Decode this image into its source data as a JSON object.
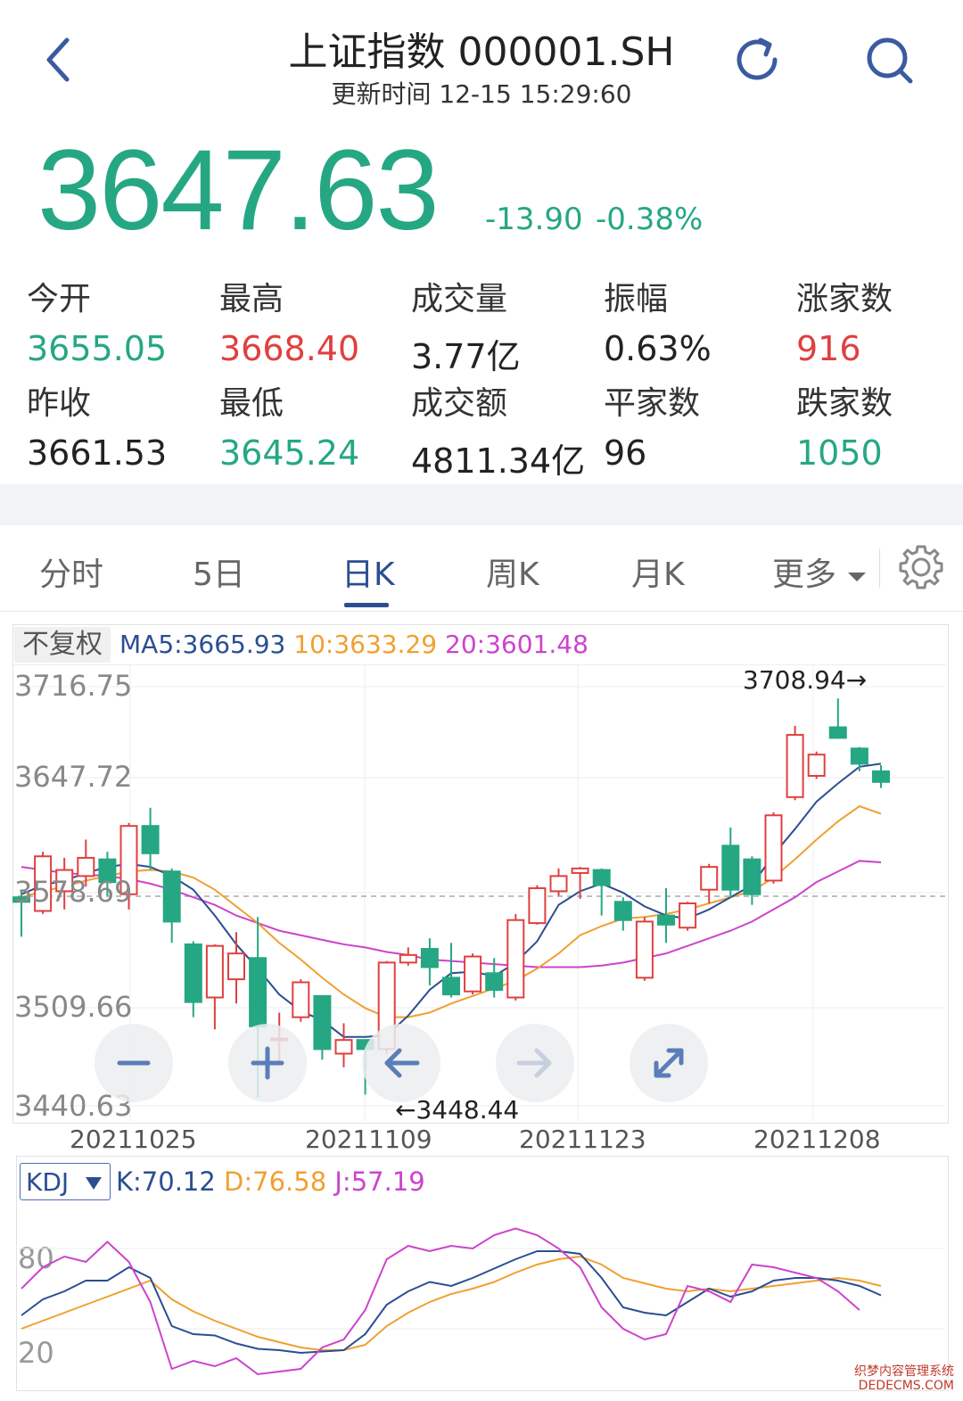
{
  "header": {
    "title": "上证指数 000001.SH",
    "update_time": "更新时间 12-15 15:29:60",
    "back_icon": "chevron-left-icon",
    "refresh_icon": "refresh-icon",
    "search_icon": "search-icon"
  },
  "quote": {
    "price": "3647.63",
    "change": "-13.90",
    "change_pct": "-0.38%"
  },
  "stats": [
    {
      "label": "今开",
      "value": "3655.05",
      "color": "green"
    },
    {
      "label": "最高",
      "value": "3668.40",
      "color": "red"
    },
    {
      "label": "成交量",
      "value": "3.77亿",
      "color": "dark"
    },
    {
      "label": "振幅",
      "value": "0.63%",
      "color": "dark"
    },
    {
      "label": "涨家数",
      "value": "916",
      "color": "red"
    },
    {
      "label": "昨收",
      "value": "3661.53",
      "color": "dark"
    },
    {
      "label": "最低",
      "value": "3645.24",
      "color": "green"
    },
    {
      "label": "成交额",
      "value": "4811.34亿",
      "color": "dark"
    },
    {
      "label": "平家数",
      "value": "96",
      "color": "dark"
    },
    {
      "label": "跌家数",
      "value": "1050",
      "color": "green"
    }
  ],
  "tabs": {
    "items": [
      "分时",
      "5日",
      "日K",
      "周K",
      "月K",
      "更多"
    ],
    "active": "日K",
    "more_icon": "caret-down-icon",
    "settings_icon": "gear-icon"
  },
  "kline": {
    "adjust_label": "不复权",
    "ma5": "MA5:3665.93",
    "ma10": "10:3633.29",
    "ma20": "20:3601.48",
    "y_ticks": [
      "3716.75",
      "3647.72",
      "3578.69",
      "3509.66",
      "3440.63"
    ],
    "x_ticks": [
      "20211025",
      "20211109",
      "20211123",
      "20211208"
    ],
    "high_annot": "3708.94→",
    "low_annot": "←3448.44",
    "colors": {
      "up": "#e04040",
      "down": "#26a783",
      "ma5": "#2b4e92",
      "ma10": "#f0a030",
      "ma20": "#cc44cc"
    },
    "zoom_buttons": [
      "minus-icon",
      "plus-icon",
      "arrow-left-icon",
      "arrow-right-icon",
      "expand-icon"
    ]
  },
  "chart_data": {
    "type": "candlestick",
    "y_range": [
      3440.63,
      3716.75
    ],
    "x_labels": [
      "20211025",
      "20211109",
      "20211123",
      "20211208"
    ],
    "candles": [
      {
        "o": 3578,
        "c": 3575,
        "h": 3582,
        "l": 3552
      },
      {
        "o": 3569,
        "c": 3605,
        "h": 3608,
        "l": 3567
      },
      {
        "o": 3582,
        "c": 3596,
        "h": 3604,
        "l": 3570
      },
      {
        "o": 3592,
        "c": 3604,
        "h": 3616,
        "l": 3585
      },
      {
        "o": 3603,
        "c": 3588,
        "h": 3608,
        "l": 3579
      },
      {
        "o": 3580,
        "c": 3625,
        "h": 3627,
        "l": 3570
      },
      {
        "o": 3625,
        "c": 3607,
        "h": 3637,
        "l": 3596
      },
      {
        "o": 3595,
        "c": 3562,
        "h": 3597,
        "l": 3548
      },
      {
        "o": 3547,
        "c": 3509,
        "h": 3549,
        "l": 3499
      },
      {
        "o": 3512,
        "c": 3546,
        "h": 3547,
        "l": 3491
      },
      {
        "o": 3524,
        "c": 3541,
        "h": 3555,
        "l": 3508
      },
      {
        "o": 3538,
        "c": 3493,
        "h": 3565,
        "l": 3446
      },
      {
        "o": 3485,
        "c": 3485,
        "h": 3502,
        "l": 3468
      },
      {
        "o": 3499,
        "c": 3522,
        "h": 3524,
        "l": 3496
      },
      {
        "o": 3513,
        "c": 3478,
        "h": 3513,
        "l": 3471
      },
      {
        "o": 3475,
        "c": 3484,
        "h": 3495,
        "l": 3466
      },
      {
        "o": 3484,
        "c": 3478,
        "h": 3484,
        "l": 3448
      },
      {
        "o": 3478,
        "c": 3535,
        "h": 3536,
        "l": 3475
      },
      {
        "o": 3535,
        "c": 3540,
        "h": 3545,
        "l": 3533
      },
      {
        "o": 3544,
        "c": 3532,
        "h": 3551,
        "l": 3520
      },
      {
        "o": 3525,
        "c": 3514,
        "h": 3548,
        "l": 3512
      },
      {
        "o": 3516,
        "c": 3539,
        "h": 3541,
        "l": 3514
      },
      {
        "o": 3528,
        "c": 3517,
        "h": 3538,
        "l": 3512
      },
      {
        "o": 3512,
        "c": 3563,
        "h": 3567,
        "l": 3510
      },
      {
        "o": 3561,
        "c": 3584,
        "h": 3586,
        "l": 3560
      },
      {
        "o": 3582,
        "c": 3592,
        "h": 3597,
        "l": 3579
      },
      {
        "o": 3594,
        "c": 3597,
        "h": 3598,
        "l": 3577
      },
      {
        "o": 3596,
        "c": 3586,
        "h": 3597,
        "l": 3566
      },
      {
        "o": 3575,
        "c": 3563,
        "h": 3578,
        "l": 3556
      },
      {
        "o": 3525,
        "c": 3562,
        "h": 3565,
        "l": 3523
      },
      {
        "o": 3566,
        "c": 3560,
        "h": 3584,
        "l": 3548
      },
      {
        "o": 3558,
        "c": 3574,
        "h": 3575,
        "l": 3556
      },
      {
        "o": 3583,
        "c": 3598,
        "h": 3600,
        "l": 3574
      },
      {
        "o": 3612,
        "c": 3583,
        "h": 3624,
        "l": 3578
      },
      {
        "o": 3603,
        "c": 3580,
        "h": 3605,
        "l": 3573
      },
      {
        "o": 3589,
        "c": 3632,
        "h": 3634,
        "l": 3587
      },
      {
        "o": 3644,
        "c": 3685,
        "h": 3691,
        "l": 3642
      },
      {
        "o": 3658,
        "c": 3672,
        "h": 3674,
        "l": 3656
      },
      {
        "o": 3690,
        "c": 3683,
        "h": 3709,
        "l": 3683
      },
      {
        "o": 3676,
        "c": 3666,
        "h": 3677,
        "l": 3661
      },
      {
        "o": 3661,
        "c": 3654,
        "h": 3665,
        "l": 3650
      }
    ],
    "ma5": [
      3580,
      3586,
      3589,
      3594,
      3598,
      3600,
      3598,
      3592,
      3583,
      3566,
      3547,
      3531,
      3514,
      3503,
      3497,
      3486,
      3486,
      3487,
      3500,
      3517,
      3528,
      3529,
      3526,
      3535,
      3549,
      3573,
      3582,
      3587,
      3581,
      3572,
      3566,
      3564,
      3570,
      3578,
      3586,
      3606,
      3623,
      3641,
      3653,
      3664,
      3666
    ],
    "ma10": [
      3578,
      3582,
      3585,
      3589,
      3592,
      3595,
      3596,
      3595,
      3591,
      3583,
      3572,
      3561,
      3548,
      3537,
      3525,
      3514,
      3505,
      3499,
      3499,
      3502,
      3508,
      3513,
      3518,
      3523,
      3531,
      3541,
      3553,
      3559,
      3564,
      3565,
      3567,
      3570,
      3574,
      3578,
      3582,
      3591,
      3603,
      3616,
      3628,
      3638,
      3633
    ],
    "ma20": [
      3598,
      3596,
      3594,
      3593,
      3592,
      3590,
      3587,
      3583,
      3578,
      3573,
      3566,
      3561,
      3556,
      3553,
      3550,
      3547,
      3545,
      3542,
      3540,
      3537,
      3536,
      3535,
      3534,
      3533,
      3532,
      3532,
      3532,
      3533,
      3535,
      3538,
      3541,
      3546,
      3551,
      3556,
      3562,
      3570,
      3578,
      3588,
      3595,
      3602,
      3601
    ]
  },
  "kdj": {
    "selector_label": "KDJ",
    "selector_icon": "triangle-down-icon",
    "k": "K:70.12",
    "d": "D:76.58",
    "j": "J:57.19",
    "y_ticks": [
      "80",
      "20"
    ],
    "k_series": [
      30,
      42,
      48,
      56,
      56,
      66,
      58,
      22,
      16,
      15,
      9,
      5,
      4,
      2,
      3,
      4,
      16,
      38,
      48,
      55,
      52,
      58,
      65,
      72,
      78,
      78,
      76,
      58,
      36,
      32,
      30,
      40,
      50,
      44,
      48,
      56,
      58,
      58,
      56,
      52,
      45
    ],
    "d_series": [
      20,
      26,
      32,
      38,
      44,
      50,
      56,
      42,
      33,
      26,
      20,
      14,
      10,
      6,
      4,
      4,
      8,
      22,
      32,
      40,
      46,
      50,
      55,
      62,
      68,
      72,
      74,
      68,
      58,
      54,
      50,
      48,
      50,
      48,
      50,
      52,
      54,
      56,
      58,
      56,
      52
    ],
    "j_series": [
      50,
      66,
      74,
      70,
      85,
      70,
      40,
      -10,
      -4,
      -8,
      -2,
      -14,
      -12,
      -10,
      6,
      12,
      34,
      72,
      82,
      78,
      82,
      80,
      90,
      95,
      90,
      80,
      66,
      36,
      20,
      12,
      16,
      52,
      48,
      40,
      68,
      66,
      62,
      58,
      48,
      34
    ]
  },
  "watermark": [
    "织梦内容管理系统",
    "DEDECMS.COM"
  ]
}
